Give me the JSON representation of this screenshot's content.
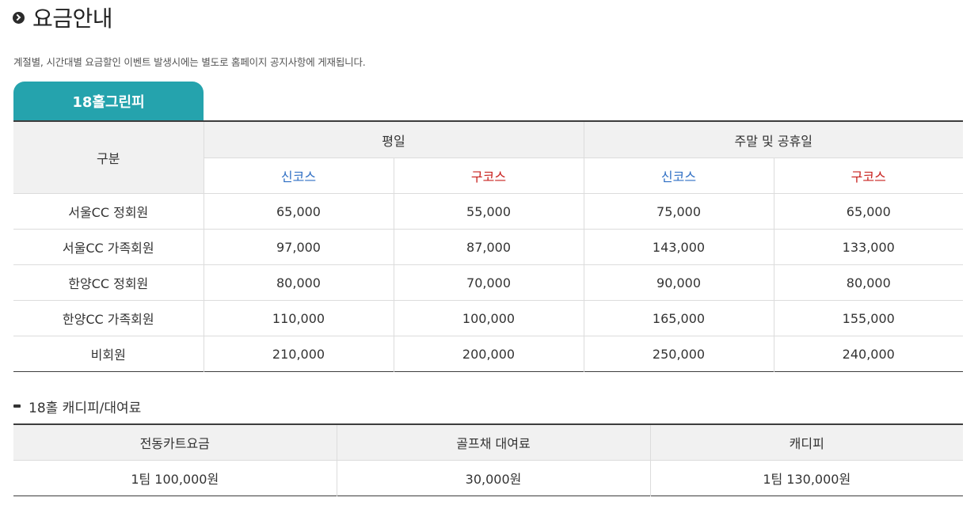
{
  "page": {
    "title": "요금안내",
    "notice": "계절별, 시간대별 요금할인 이벤트 발생시에는 별도로 홈페이지 공지사항에 게재됩니다."
  },
  "green_fee": {
    "tab_label": "18홀그린피",
    "category_header": "구분",
    "group_headers": [
      "평일",
      "주말 및 공휴일"
    ],
    "course_headers": [
      "신코스",
      "구코스",
      "신코스",
      "구코스"
    ],
    "rows": [
      {
        "label": "서울CC 정회원",
        "values": [
          "65,000",
          "55,000",
          "75,000",
          "65,000"
        ]
      },
      {
        "label": "서울CC 가족회원",
        "values": [
          "97,000",
          "87,000",
          "143,000",
          "133,000"
        ]
      },
      {
        "label": "한양CC 정회원",
        "values": [
          "80,000",
          "70,000",
          "90,000",
          "80,000"
        ]
      },
      {
        "label": "한양CC 가족회원",
        "values": [
          "110,000",
          "100,000",
          "165,000",
          "155,000"
        ]
      },
      {
        "label": "비회원",
        "values": [
          "210,000",
          "200,000",
          "250,000",
          "240,000"
        ]
      }
    ],
    "colors": {
      "new_course": "#2f6fc4",
      "old_course": "#c8201d",
      "tab": "#25a3ad"
    }
  },
  "caddie": {
    "title": "18홀 캐디피/대여료",
    "headers": [
      "전동카트요금",
      "골프채 대여료",
      "캐디피"
    ],
    "values": [
      "1팀 100,000원",
      "30,000원",
      "1팀 130,000원"
    ]
  }
}
